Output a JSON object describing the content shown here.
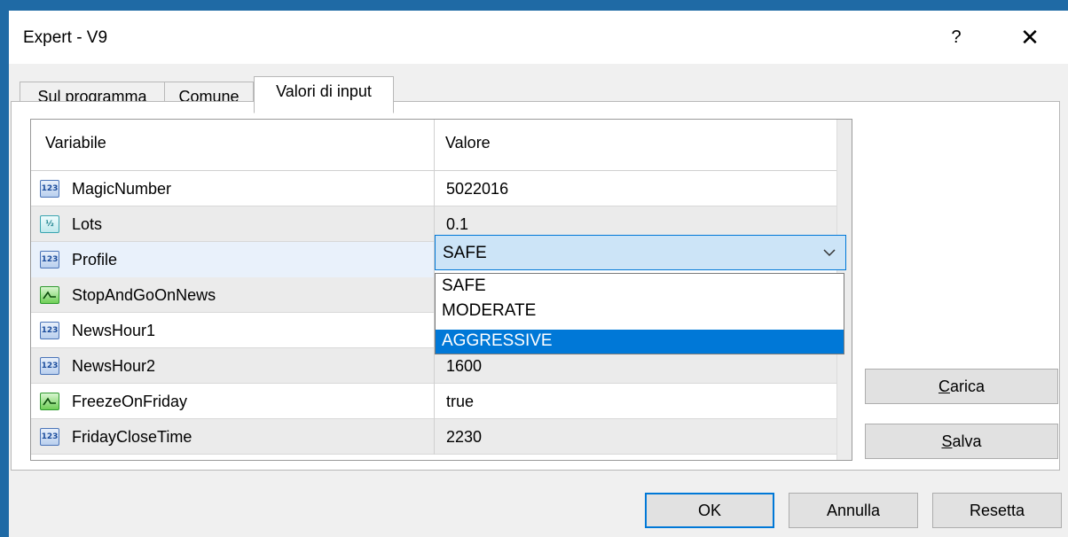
{
  "window": {
    "title": "Expert - V9",
    "help_label": "?",
    "close_label": "✕"
  },
  "tabs": [
    {
      "label": "Sul programma",
      "active": false
    },
    {
      "label": "Comune",
      "active": false
    },
    {
      "label": "Valori di input",
      "active": true
    }
  ],
  "grid": {
    "headers": {
      "variable": "Variabile",
      "value": "Valore"
    },
    "rows": [
      {
        "name": "MagicNumber",
        "value": "5022016",
        "icon": "integer-icon"
      },
      {
        "name": "Lots",
        "value": "0.1",
        "icon": "fraction-icon"
      },
      {
        "name": "Profile",
        "value": "SAFE",
        "icon": "integer-icon"
      },
      {
        "name": "StopAndGoOnNews",
        "value": "",
        "icon": "boolean-icon"
      },
      {
        "name": "NewsHour1",
        "value": "",
        "icon": "integer-icon"
      },
      {
        "name": "NewsHour2",
        "value": "1600",
        "icon": "integer-icon"
      },
      {
        "name": "FreezeOnFriday",
        "value": "true",
        "icon": "boolean-icon"
      },
      {
        "name": "FridayCloseTime",
        "value": "2230",
        "icon": "integer-icon"
      }
    ],
    "icon_text": {
      "integer": "123",
      "fraction": "½"
    }
  },
  "profile_dropdown": {
    "selected": "SAFE",
    "options": [
      "SAFE",
      "MODERATE",
      "AGGRESSIVE"
    ],
    "highlighted": "AGGRESSIVE"
  },
  "side_buttons": {
    "load_prefix": "C",
    "load_rest": "arica",
    "save_prefix": "S",
    "save_rest": "alva"
  },
  "footer_buttons": {
    "ok": "OK",
    "cancel": "Annulla",
    "reset": "Resetta"
  },
  "colors": {
    "accent": "#0078d7",
    "titlebar_border": "#1f6aa5",
    "combo_bg": "#cce4f7"
  }
}
